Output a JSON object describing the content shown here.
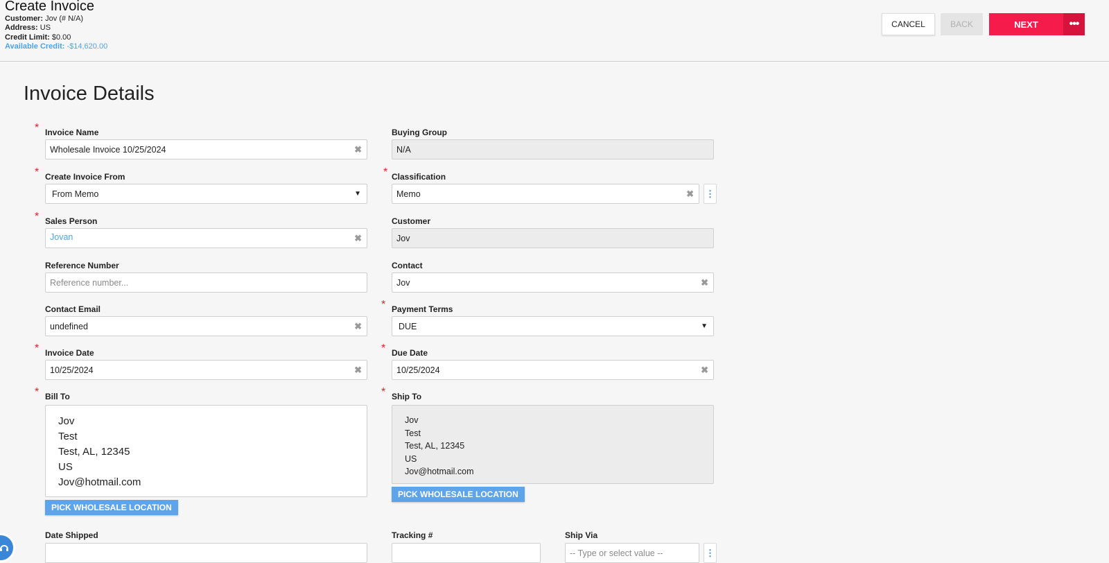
{
  "header": {
    "title": "Create Invoice",
    "customer_label": "Customer:",
    "customer_value": "Jov (# N/A)",
    "address_label": "Address:",
    "address_value": "US",
    "credit_limit_label": "Credit Limit:",
    "credit_limit_value": "$0.00",
    "available_credit_label": "Available Credit:",
    "available_credit_value": "-$14,620.00"
  },
  "toolbar": {
    "cancel_label": "CANCEL",
    "back_label": "BACK",
    "next_label": "NEXT",
    "more_label": "•••"
  },
  "page": {
    "title": "Invoice Details"
  },
  "form": {
    "invoice_name": {
      "label": "Invoice Name",
      "value": "Wholesale Invoice 10/25/2024"
    },
    "buying_group": {
      "label": "Buying Group",
      "value": "N/A"
    },
    "create_invoice_from": {
      "label": "Create Invoice From",
      "value": "From Memo"
    },
    "classification": {
      "label": "Classification",
      "value": "Memo"
    },
    "sales_person": {
      "label": "Sales Person",
      "value": "Jovan"
    },
    "customer": {
      "label": "Customer",
      "value": "Jov"
    },
    "reference_number": {
      "label": "Reference Number",
      "placeholder": "Reference number..."
    },
    "contact": {
      "label": "Contact",
      "value": "Jov"
    },
    "contact_email": {
      "label": "Contact Email",
      "value": "undefined"
    },
    "payment_terms": {
      "label": "Payment Terms",
      "value": "DUE"
    },
    "invoice_date": {
      "label": "Invoice Date",
      "value": "10/25/2024"
    },
    "due_date": {
      "label": "Due Date",
      "value": "10/25/2024"
    },
    "bill_to": {
      "label": "Bill To",
      "lines": [
        "Jov",
        "Test",
        "Test, AL, 12345",
        "US",
        "Jov@hotmail.com"
      ]
    },
    "ship_to": {
      "label": "Ship To",
      "lines": [
        "Jov",
        "Test",
        "Test, AL, 12345",
        "US",
        "Jov@hotmail.com"
      ]
    },
    "pick_location_label": "PICK WHOLESALE LOCATION",
    "date_shipped": {
      "label": "Date Shipped",
      "value": ""
    },
    "tracking": {
      "label": "Tracking #",
      "value": ""
    },
    "ship_via": {
      "label": "Ship Via",
      "placeholder": "-- Type or select value --"
    },
    "required_mark": "*",
    "clear_glyph": "✖",
    "kebab_glyph": "⋮",
    "chevron_glyph": "⌄"
  },
  "colors": {
    "primary": "#f51c4b",
    "primary_dark": "#d5133c",
    "link": "#4ea3e8",
    "pick_button": "#5da4ea",
    "required": "#d8262d"
  },
  "icons": {
    "clear": "close-icon",
    "kebab": "more-vertical-icon",
    "chevron": "chevron-down-icon",
    "more": "more-horizontal-icon",
    "chat": "chat-icon"
  }
}
